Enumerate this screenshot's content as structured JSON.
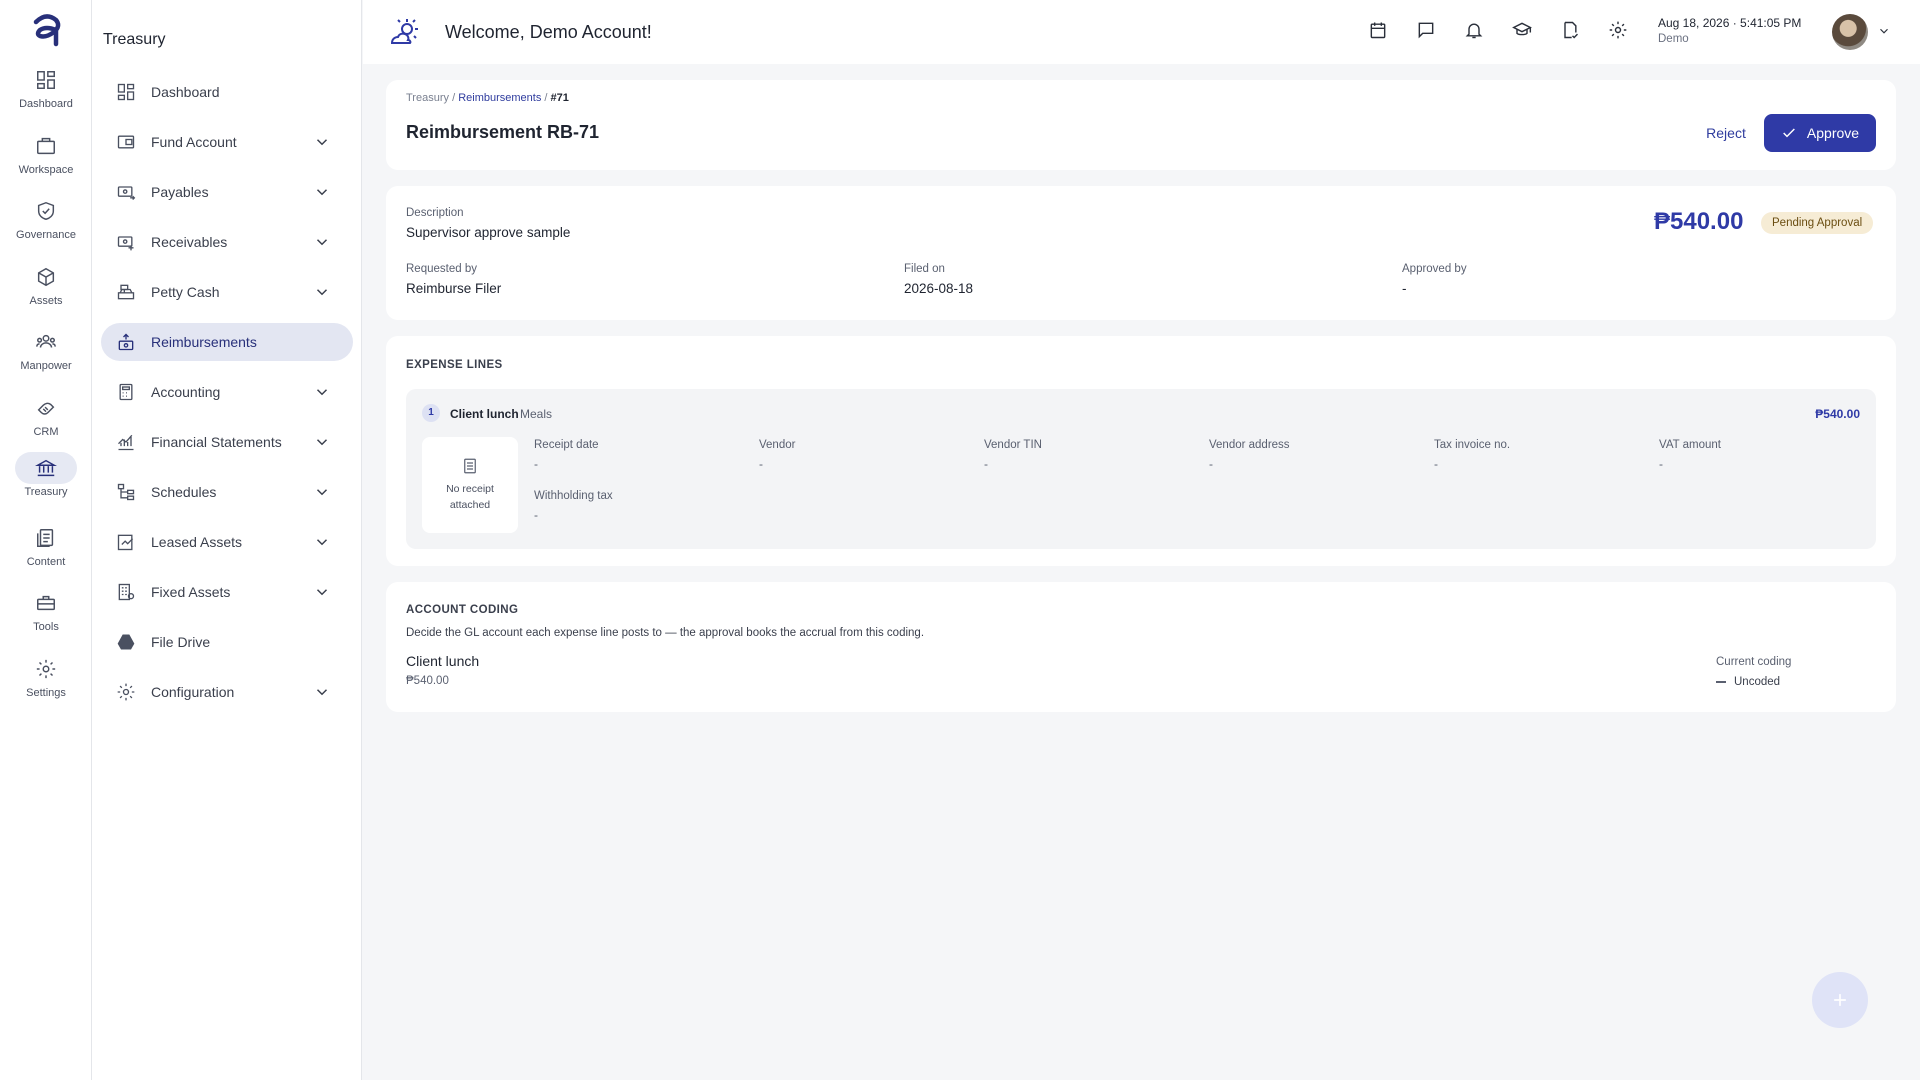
{
  "rail": {
    "items": [
      {
        "label": "Dashboard",
        "icon": "dashboard-icon"
      },
      {
        "label": "Workspace",
        "icon": "briefcase-icon"
      },
      {
        "label": "Governance",
        "icon": "shield-check-icon"
      },
      {
        "label": "Assets",
        "icon": "cube-icon"
      },
      {
        "label": "Manpower",
        "icon": "people-icon"
      },
      {
        "label": "CRM",
        "icon": "handshake-icon"
      },
      {
        "label": "Treasury",
        "icon": "bank-icon"
      },
      {
        "label": "Content",
        "icon": "document-icon"
      },
      {
        "label": "Tools",
        "icon": "toolbox-icon"
      },
      {
        "label": "Settings",
        "icon": "gear-icon"
      }
    ],
    "active": "Treasury"
  },
  "sidebar": {
    "title": "Treasury",
    "items": [
      {
        "label": "Dashboard",
        "icon": "dashboard-icon",
        "expandable": false
      },
      {
        "label": "Fund Account",
        "icon": "wallet-icon",
        "expandable": true
      },
      {
        "label": "Payables",
        "icon": "money-out-icon",
        "expandable": true
      },
      {
        "label": "Receivables",
        "icon": "money-in-icon",
        "expandable": true
      },
      {
        "label": "Petty Cash",
        "icon": "cash-register-icon",
        "expandable": true
      },
      {
        "label": "Reimbursements",
        "icon": "reimbursement-icon",
        "expandable": false
      },
      {
        "label": "Accounting",
        "icon": "calculator-icon",
        "expandable": true
      },
      {
        "label": "Financial Statements",
        "icon": "chart-icon",
        "expandable": true
      },
      {
        "label": "Schedules",
        "icon": "tree-icon",
        "expandable": true
      },
      {
        "label": "Leased Assets",
        "icon": "leased-icon",
        "expandable": true
      },
      {
        "label": "Fixed Assets",
        "icon": "building-icon",
        "expandable": true
      },
      {
        "label": "File Drive",
        "icon": "drive-icon",
        "expandable": false
      },
      {
        "label": "Configuration",
        "icon": "gear-icon",
        "expandable": true
      }
    ],
    "active": "Reimbursements"
  },
  "header": {
    "title": "Welcome, Demo Account!",
    "datetime": "Aug 18, 2026 · 5:41:05 PM",
    "subtitle": "Demo"
  },
  "breadcrumb": {
    "root": "Treasury",
    "sep": "/",
    "section": "Reimbursements",
    "current": "#71"
  },
  "page": {
    "title": "Reimbursement RB-71",
    "reject_label": "Reject",
    "approve_label": "Approve"
  },
  "summary": {
    "description_label": "Description",
    "description": "Supervisor approve sample",
    "amount": "₱540.00",
    "status": "Pending Approval",
    "requested_by_label": "Requested by",
    "requested_by": "Reimburse Filer",
    "filed_on_label": "Filed on",
    "filed_on": "2026-08-18",
    "approved_by_label": "Approved by",
    "approved_by": "-"
  },
  "expense_lines": {
    "title": "EXPENSE LINES",
    "lines": [
      {
        "no": "1",
        "name": "Client lunch",
        "category": "Meals",
        "amount": "₱540.00",
        "receipt_text": "No receipt attached",
        "fields": [
          {
            "label": "Receipt date",
            "value": "-"
          },
          {
            "label": "Vendor",
            "value": "-"
          },
          {
            "label": "Vendor TIN",
            "value": "-"
          },
          {
            "label": "Vendor address",
            "value": "-"
          },
          {
            "label": "Tax invoice no.",
            "value": "-"
          },
          {
            "label": "VAT amount",
            "value": "-"
          },
          {
            "label": "Withholding tax",
            "value": "-"
          }
        ]
      }
    ]
  },
  "account_coding": {
    "title": "ACCOUNT CODING",
    "description": "Decide the GL account each expense line posts to — the approval books the accrual from this coding.",
    "line_name": "Client lunch",
    "line_amount": "₱540.00",
    "current_label": "Current coding",
    "current_value": "Uncoded"
  },
  "colors": {
    "accent": "#2f3aa6",
    "badge_bg": "#f6ecd5",
    "badge_text": "#6b4e12"
  }
}
